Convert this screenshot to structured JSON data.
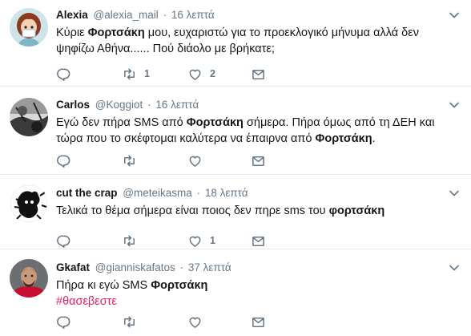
{
  "tweets": [
    {
      "name": "Alexia",
      "handle": "@alexia_mail",
      "separator": "·",
      "time": "16 λεπτά",
      "text_parts": [
        "Κύριε ",
        "Φορτσάκη",
        " μου, ευχαριστώ για το προεκλογικό μήνυμα αλλά δεν ψηφίζω Αθήνα...... Πού διάολο με βρήκατε;"
      ],
      "retweets": "1",
      "likes": "2",
      "avatar_icon": "avatar-girl-icon"
    },
    {
      "name": "Carlos",
      "handle": "@Koggiot",
      "separator": "·",
      "time": "16 λεπτά",
      "text_parts": [
        "Εγώ δεν πήρα SMS από ",
        "Φορτσάκη",
        " σήμερα. Πήρα όμως από τη ΔΕΗ και τώρα που το σκέφτομαι καλύτερα να έπαιρνα από ",
        "Φορτσάκη",
        "."
      ],
      "retweets": "",
      "likes": "",
      "avatar_icon": "avatar-bw-icon"
    },
    {
      "name": "cut the crap",
      "handle": "@meteikasma",
      "separator": "·",
      "time": "18 λεπτά",
      "text_parts": [
        "Τελικά το θέμα σήμερα είναι ποιος δεν πηρε sms του ",
        "φορτσάκη"
      ],
      "retweets": "",
      "likes": "1",
      "avatar_icon": "avatar-silhouette-icon"
    },
    {
      "name": "Gkafat",
      "handle": "@gianniskafatos",
      "separator": "·",
      "time": "37 λεπτά",
      "text_parts": [
        "Πήρα κι εγώ SMS ",
        "Φορτσάκη"
      ],
      "hashtag": "#θασεβεστε",
      "retweets": "",
      "likes": "",
      "avatar_icon": "avatar-man-icon"
    }
  ],
  "icons": [
    "reply-icon",
    "retweet-icon",
    "like-icon",
    "direct-message-icon",
    "chevron-down-icon"
  ],
  "colors": {
    "text": "#14171a",
    "secondary": "#657786",
    "divider": "#e6ecf0",
    "hashtag": "#e0245e"
  }
}
